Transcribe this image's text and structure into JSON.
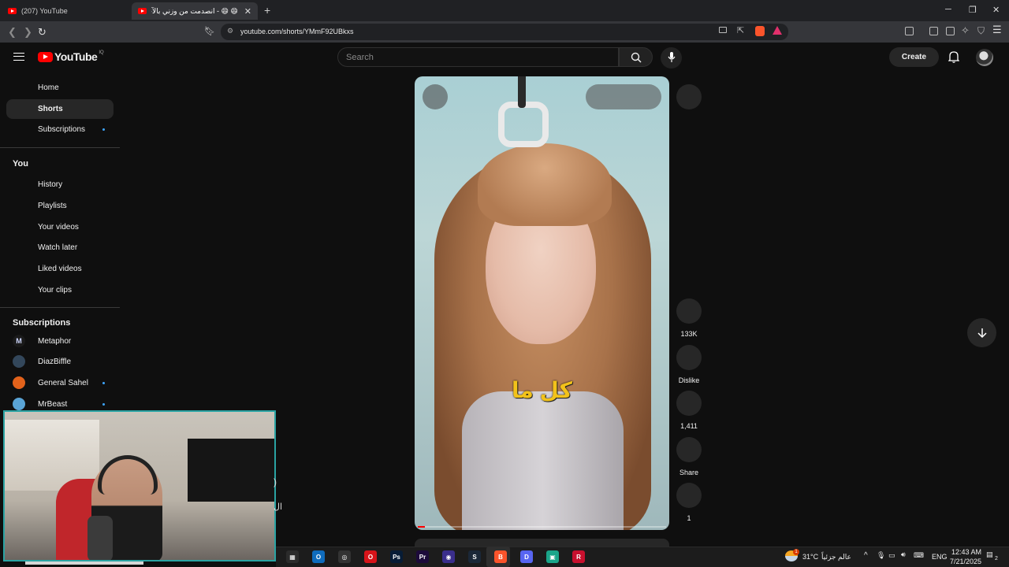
{
  "browser": {
    "tabs": [
      {
        "title": "(207) YouTube",
        "close": ""
      },
      {
        "title": "😄 😄 - انصدمت من وزني بالآخر",
        "close": "✕"
      }
    ],
    "new_tab": "+",
    "window_buttons": [
      "─",
      "❐",
      "✕"
    ],
    "url": "youtube.com/shorts/YMmF92UBkxs"
  },
  "header": {
    "logo_word": "YouTube",
    "logo_country": "IQ",
    "search_placeholder": "Search",
    "create_label": "Create"
  },
  "sidebar": {
    "main": [
      {
        "label": "Home"
      },
      {
        "label": "Shorts"
      },
      {
        "label": "Subscriptions"
      }
    ],
    "you_heading": "You",
    "you_items": [
      {
        "label": "History"
      },
      {
        "label": "Playlists"
      },
      {
        "label": "Your videos"
      },
      {
        "label": "Watch later"
      },
      {
        "label": "Liked videos"
      },
      {
        "label": "Your clips"
      }
    ],
    "subscriptions_heading": "Subscriptions",
    "subscriptions": [
      {
        "label": "Metaphor",
        "initial": "M",
        "color": "#1a1a1a"
      },
      {
        "label": "DiazBiffle",
        "initial": "",
        "color": "#33475b"
      },
      {
        "label": "General Sahel",
        "initial": "",
        "color": "#e2621b"
      },
      {
        "label": "MrBeast",
        "initial": "",
        "color": "#5aa4d6"
      }
    ]
  },
  "short": {
    "caption": "كل ما",
    "progress_fraction": 0.03,
    "actions": [
      {
        "name": "like",
        "label": "133K"
      },
      {
        "name": "dislike",
        "label": "Dislike"
      },
      {
        "name": "comments",
        "label": "1,411"
      },
      {
        "name": "share",
        "label": "Share"
      },
      {
        "name": "remix",
        "label": "1"
      }
    ]
  },
  "webcam_edge": {
    "a": ")",
    "b": "ال"
  },
  "taskbar": {
    "apps": [
      {
        "glyph": "▦",
        "color": "#2b2b2b"
      },
      {
        "glyph": "O",
        "color": "#0f6cbd"
      },
      {
        "glyph": "◎",
        "color": "#333333"
      },
      {
        "glyph": "O",
        "color": "#d7141a"
      },
      {
        "glyph": "Ps",
        "color": "#071c36"
      },
      {
        "glyph": "Pr",
        "color": "#1c0a3a"
      },
      {
        "glyph": "◉",
        "color": "#3a2e8c"
      },
      {
        "glyph": "S",
        "color": "#1b2838"
      },
      {
        "glyph": "B",
        "color": "#fb542b"
      },
      {
        "glyph": "D",
        "color": "#5865f2"
      },
      {
        "glyph": "▣",
        "color": "#1aa58a"
      },
      {
        "glyph": "R",
        "color": "#c8102e"
      }
    ],
    "weather_badge": "1",
    "temperature": "31°C",
    "weather_text": "عالم جزئياً",
    "language": "ENG",
    "time": "12:43 AM",
    "date": "7/21/2025",
    "notification_count": "2"
  }
}
